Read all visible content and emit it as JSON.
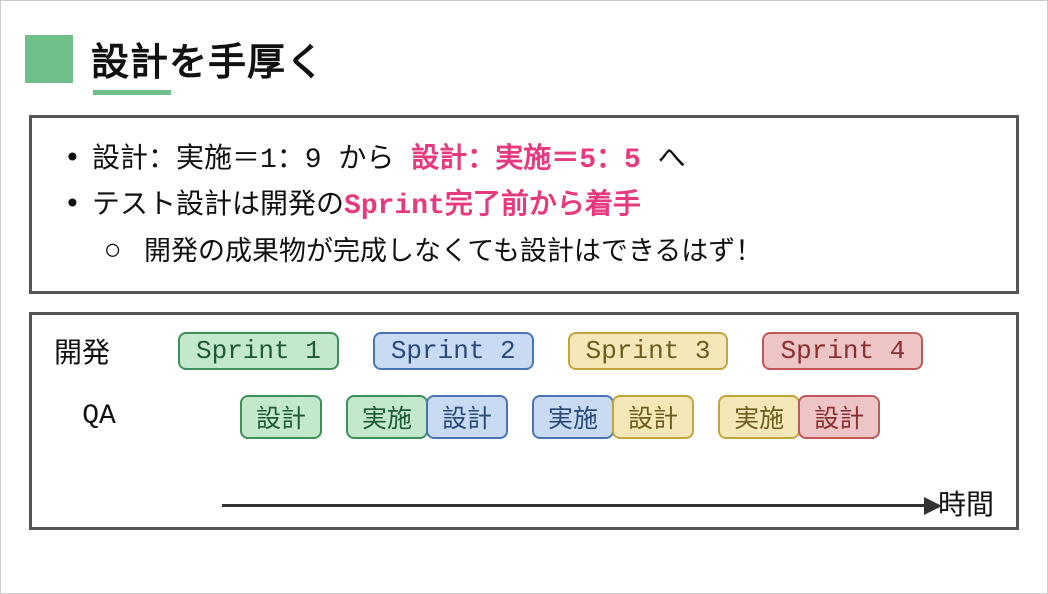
{
  "title": "設計を手厚く",
  "bullets": {
    "b1_pre": "設計：実施＝1：9 から ",
    "b1_emph": "設計：実施＝5：5",
    "b1_post": " へ",
    "b2_pre": "テスト設計は開発の",
    "b2_emph": "Sprint完了前から着手",
    "b2_sub": "開発の成果物が完成しなくても設計はできるはず！"
  },
  "diagram": {
    "dev_label": "開発",
    "qa_label": "QA",
    "time_label": "時間",
    "sprints": [
      "Sprint 1",
      "Sprint 2",
      "Sprint 3",
      "Sprint 4"
    ],
    "qa_design": "設計",
    "qa_exec": "実施"
  },
  "colors": {
    "green": "#c3e8cc",
    "blue": "#c9dbf3",
    "yellow": "#f5e8b8",
    "red": "#edc5c6",
    "accent": "#6fbf8b",
    "emph": "#e6397f"
  }
}
